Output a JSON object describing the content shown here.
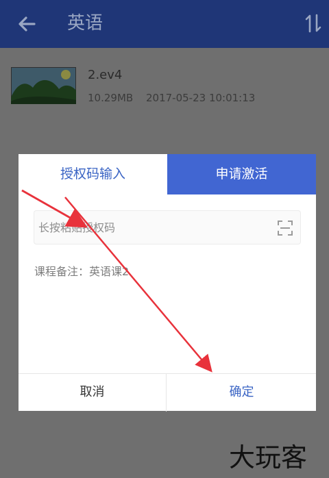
{
  "app_bar": {
    "title": "英语",
    "back_icon": "arrow-left-icon",
    "sort_icon": "sort-icon",
    "background_color": "#1f3677"
  },
  "file_list": [
    {
      "name": "2.ev4",
      "size": "10.29MB",
      "date": "2017-05-23 10:01:13",
      "thumbnail_icon": "landscape-thumbnail-icon"
    }
  ],
  "dialog": {
    "tabs": [
      {
        "label": "授权码输入",
        "active": false
      },
      {
        "label": "申请激活",
        "active": true
      }
    ],
    "code_input": {
      "value": "",
      "placeholder": "长按粘贴授权码",
      "scan_icon": "scan-qr-icon"
    },
    "course_note": "课程备注：英语课2",
    "cancel_label": "取消",
    "confirm_label": "确定",
    "accent_color": "#4166d2"
  },
  "annotation_arrows": {
    "color": "#e8323b"
  },
  "watermark": "大玩客"
}
